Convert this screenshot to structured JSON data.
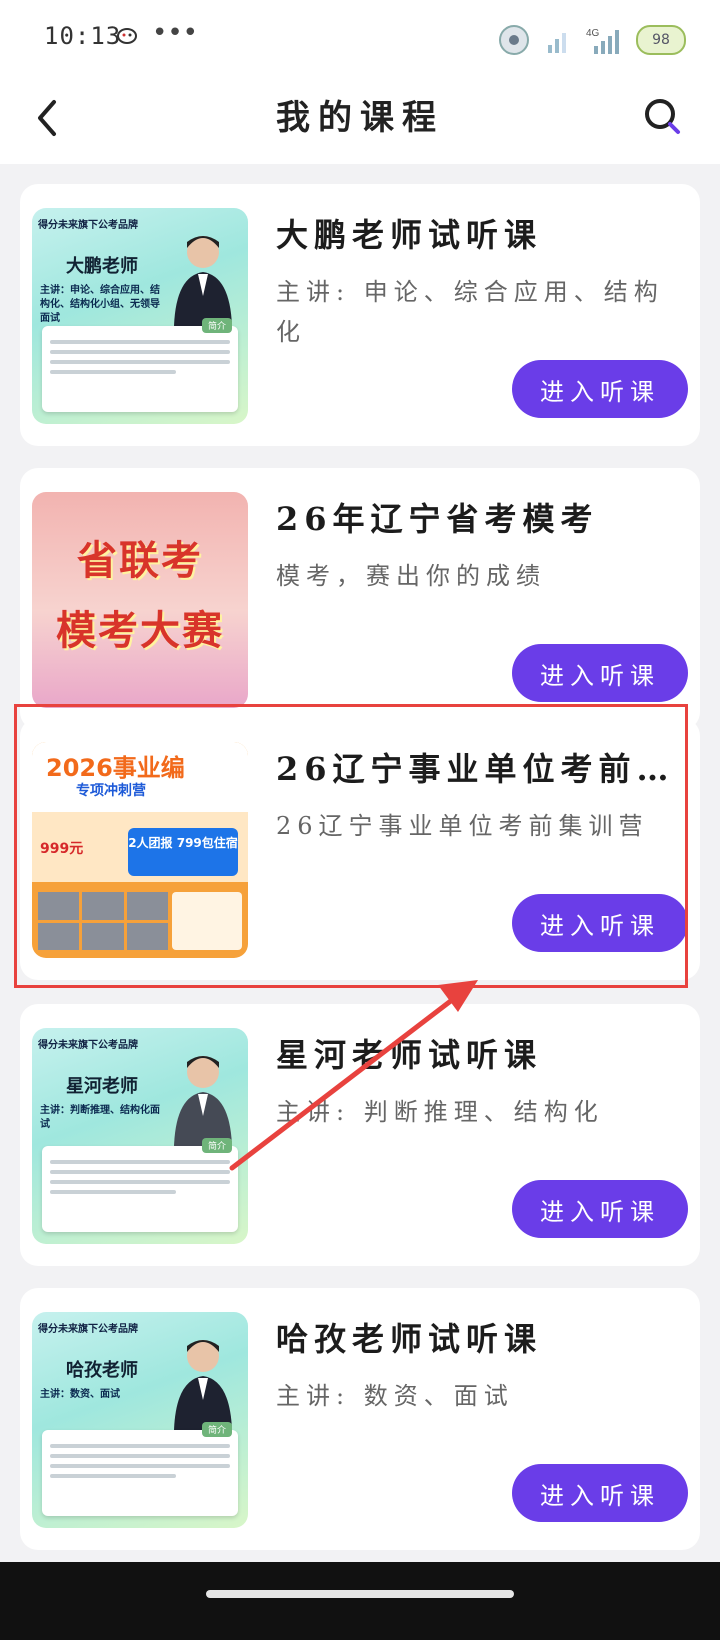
{
  "status_bar": {
    "time": "10:13",
    "dots": "•••",
    "battery": "98"
  },
  "header": {
    "title": "我的课程"
  },
  "courses": [
    {
      "title": "大鹏老师试听课",
      "desc": "主讲: 申论、综合应用、结构化",
      "button": "进入听课",
      "thumb": {
        "top": "得分未来旗下公考品牌",
        "name": "大鹏老师",
        "sub": "主讲：申论、综合应用、结构化、结构化小组、无领导面试",
        "tag": "简介"
      }
    },
    {
      "title": "26年辽宁省考模考",
      "desc": "模考，赛出你的成绩",
      "button": "进入听课",
      "thumb": {
        "line1": "省联考",
        "line2": "模考大赛"
      }
    },
    {
      "title": "26辽宁事业单位考前…",
      "desc": "26辽宁事业单位考前集训营",
      "button": "进入听课",
      "thumb": {
        "year": "2026事业编",
        "sub": "专项冲刺营",
        "price": "999元",
        "group": "2人团报 799包住宿"
      }
    },
    {
      "title": "星河老师试听课",
      "desc": "主讲: 判断推理、结构化",
      "button": "进入听课",
      "thumb": {
        "top": "得分未来旗下公考品牌",
        "name": "星河老师",
        "sub": "主讲：判断推理、结构化面试",
        "tag": "简介"
      }
    },
    {
      "title": "哈孜老师试听课",
      "desc": "主讲: 数资、面试",
      "button": "进入听课",
      "thumb": {
        "top": "得分未来旗下公考品牌",
        "name": "哈孜老师",
        "sub": "主讲：数资、面试",
        "tag": "简介"
      }
    }
  ],
  "colors": {
    "accent": "#6a3de8",
    "highlight": "#e8423e"
  }
}
